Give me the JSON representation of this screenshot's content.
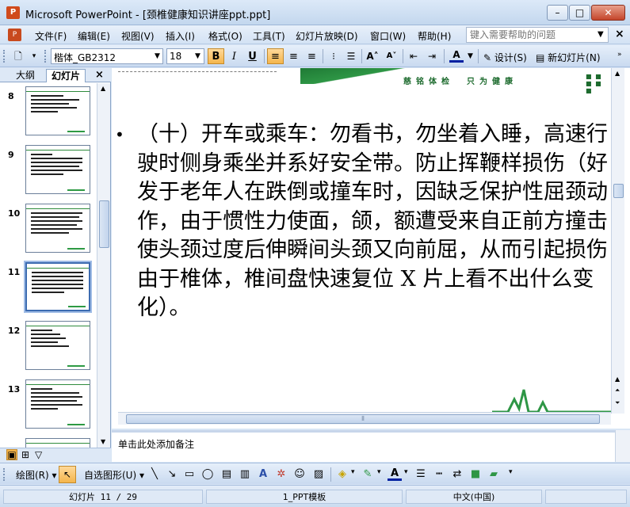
{
  "window": {
    "title": "Microsoft PowerPoint - [颈椎健康知识讲座ppt.ppt]",
    "app_icon": "P"
  },
  "menu": {
    "items": [
      "文件(F)",
      "编辑(E)",
      "视图(V)",
      "插入(I)",
      "格式(O)",
      "工具(T)",
      "幻灯片放映(D)",
      "窗口(W)",
      "帮助(H)"
    ],
    "help_placeholder": "键入需要帮助的问题"
  },
  "format_toolbar": {
    "font_name": "楷体_GB2312",
    "font_size": "18",
    "bold": "B",
    "italic": "I",
    "underline": "U",
    "font_color_label": "A",
    "design_label": "设计(S)",
    "new_slide_label": "新幻灯片(N)"
  },
  "left_pane": {
    "tab_outline": "大纲",
    "tab_slides": "幻灯片",
    "close": "×",
    "thumbnails": [
      {
        "num": "8",
        "selected": false
      },
      {
        "num": "9",
        "selected": false
      },
      {
        "num": "10",
        "selected": false
      },
      {
        "num": "11",
        "selected": true
      },
      {
        "num": "12",
        "selected": false
      },
      {
        "num": "13",
        "selected": false
      }
    ]
  },
  "slide": {
    "slogan": "慈铭体检　只为健康",
    "body": "（十）开车或乘车：勿看书，勿坐着入睡，高速行驶时侧身乘坐并系好安全带。防止挥鞭样损伤（好发于老年人在跌倒或撞车时，因缺乏保护性屈颈动作，由于惯性力使面，颌，额遭受来自正前方撞击使头颈过度后伸瞬间头颈又向前屈，从而引起损伤由于椎体，椎间盘快速复位 X 片上看不出什么变化）。"
  },
  "notes": {
    "placeholder": "单击此处添加备注"
  },
  "draw_toolbar": {
    "draw_label": "绘图(R)",
    "autoshape_label": "自选图形(U)"
  },
  "status": {
    "slide": "幻灯片 11 / 29",
    "template": "1_PPT模板",
    "language": "中文(中国)"
  },
  "colors": {
    "accent_green": "#2e9645",
    "selection_orange": "#f4b54c",
    "chrome_blue": "#c9daf0"
  }
}
